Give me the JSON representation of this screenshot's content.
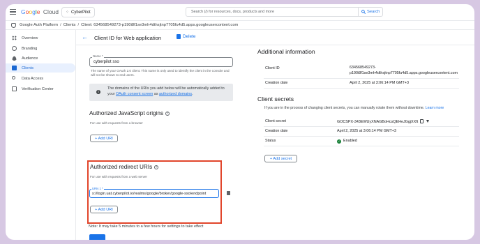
{
  "app": {
    "brand_letters": [
      "G",
      "o",
      "o",
      "g",
      "l",
      "e"
    ],
    "brand_suffix": "Cloud",
    "project": "CyberPilot"
  },
  "search": {
    "placeholder": "Search (/) for resources, docs, products and more",
    "button": "Search"
  },
  "breadcrumb": {
    "root": "Google Auth Platform",
    "clients": "Clients",
    "current": "Client: 634568549273-p190i8f1se3mh4dthsjtnp7705fu4d5.apps.googleusercontent.com"
  },
  "sidebar": {
    "items": [
      {
        "label": "Overview",
        "icon": "dashboard-icon"
      },
      {
        "label": "Branding",
        "icon": "branding-icon"
      },
      {
        "label": "Audience",
        "icon": "audience-icon"
      },
      {
        "label": "Clients",
        "icon": "clients-icon",
        "active": true
      },
      {
        "label": "Data Access",
        "icon": "key-icon"
      },
      {
        "label": "Verification Center",
        "icon": "verification-icon"
      }
    ]
  },
  "header": {
    "title": "Client ID for Web application",
    "delete": "Delete"
  },
  "form": {
    "name_label": "Name *",
    "name_value": "cyberpilot sso",
    "name_helper": "The name of your OAuth 2.0 client. This name is only used to identify the client in the console and will not be shown to end users.",
    "info_prefix": "The domains of the URIs you add below will be automatically added to your ",
    "info_link1": "OAuth consent screen",
    "info_mid": " as ",
    "info_link2": "authorized domains",
    "info_suffix": ".",
    "js_title": "Authorized JavaScript origins",
    "js_sub": "For use with requests from a browser",
    "js_add": "+ Add URI",
    "redirect_title": "Authorized redirect URIs",
    "redirect_sub": "For use with requests from a web server",
    "uri_label": "URIs 1 *",
    "uri_value": "s://login.uat.cyberpilot.io/realms/google/broker/google-sso/endpoint",
    "redirect_add": "+ Add URI",
    "note": "Note: It may take 5 minutes to a few hours for settings to take effect"
  },
  "additional": {
    "title": "Additional information",
    "client_id_label": "Client ID",
    "client_id_value_1": "634568549273-",
    "client_id_value_2": "p190i8f1se3mh4dthsjtnp7705fu4d5.apps.googleusercontent.com",
    "creation_label": "Creation date",
    "creation_value": "April 2, 2025 at 3:06:14 PM GMT+3"
  },
  "secrets": {
    "title": "Client secrets",
    "subtitle": "If you are in the process of changing client secrets, you can manually rotate them without downtime.",
    "learn_more": "Learn more",
    "secret_label": "Client secret",
    "secret_value": "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",
    "creation_label": "Creation date",
    "creation_value": "April 2, 2025 at 3:06:14 PM GMT+3",
    "status_label": "Status",
    "status_value": "Enabled",
    "add_secret": "+ Add secret"
  }
}
